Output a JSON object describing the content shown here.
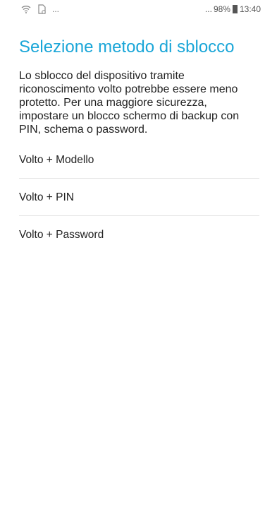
{
  "status_bar": {
    "notifications_more": "...",
    "signal_more": "...",
    "battery": "98%",
    "time": "13:40"
  },
  "page": {
    "title": "Selezione metodo di sblocco",
    "description": "Lo sblocco del dispositivo tramite riconoscimento volto potrebbe essere meno protetto. Per una maggiore sicurezza, impostare un blocco schermo di backup con PIN, schema o password."
  },
  "options": [
    {
      "label": "Volto + Modello"
    },
    {
      "label": "Volto + PIN"
    },
    {
      "label": "Volto + Password"
    }
  ]
}
